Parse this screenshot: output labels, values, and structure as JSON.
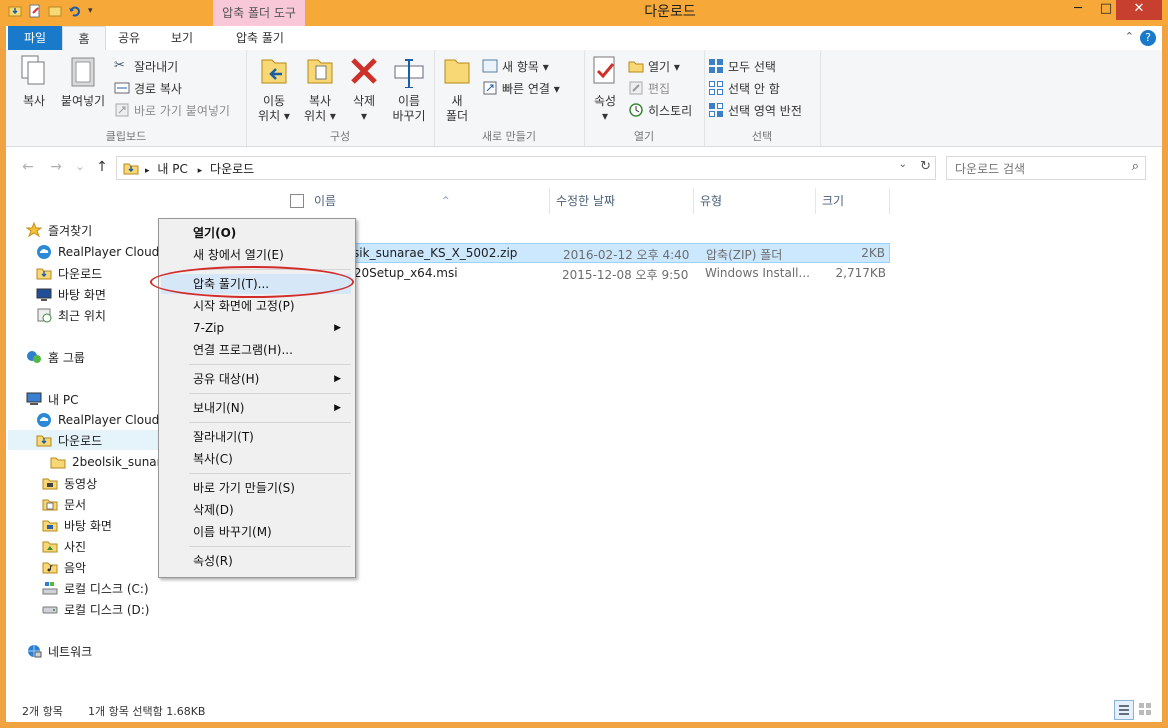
{
  "window": {
    "title": "다운로드",
    "contextual_tool": "압축 폴더 도구",
    "min_glyph": "─",
    "max_glyph": "□",
    "close_glyph": "✕"
  },
  "tabs": {
    "file": "파일",
    "home": "홈",
    "share": "공유",
    "view": "보기",
    "extract": "압축 풀기",
    "help": "?"
  },
  "ribbon": {
    "clipboard": {
      "label": "클립보드",
      "copy": "복사",
      "paste": "붙여넣기",
      "cut": "잘라내기",
      "copy_path": "경로 복사",
      "paste_shortcut": "바로 가기 붙여넣기"
    },
    "organize": {
      "label": "구성",
      "move_to_1": "이동",
      "move_to_2": "위치 ▾",
      "copy_to_1": "복사",
      "copy_to_2": "위치 ▾",
      "delete_1": "삭제",
      "delete_2": "▾",
      "rename_1": "이름",
      "rename_2": "바꾸기"
    },
    "new": {
      "label": "새로 만들기",
      "new_folder_1": "새",
      "new_folder_2": "폴더",
      "new_item": "새 항목 ▾",
      "easy_access": "빠른 연결 ▾"
    },
    "open": {
      "label": "열기",
      "properties_1": "속성",
      "properties_2": "▾",
      "open": "열기 ▾",
      "edit": "편집",
      "history": "히스토리"
    },
    "select": {
      "label": "선택",
      "select_all": "모두 선택",
      "select_none": "선택 안 함",
      "invert": "선택 영역 반전"
    }
  },
  "address": {
    "back": "←",
    "forward": "→",
    "recent": "⌄",
    "up": "↑",
    "root_sep": "▸",
    "pc": "내 PC",
    "sep": "▸",
    "folder": "다운로드",
    "dropdown": "⌄",
    "refresh": "↻",
    "search_placeholder": "다운로드 검색",
    "search_glyph": "⌕"
  },
  "navpane": [
    {
      "label": "즐겨찾기",
      "icon": "star-icon"
    },
    {
      "label": "RealPlayer Cloud",
      "icon": "cloud-icon"
    },
    {
      "label": "다운로드",
      "icon": "download-folder-icon"
    },
    {
      "label": "바탕 화면",
      "icon": "desktop-icon"
    },
    {
      "label": "최근 위치",
      "icon": "recent-places-icon"
    },
    {
      "label": "홈 그룹",
      "icon": "homegroup-icon"
    },
    {
      "label": "내 PC",
      "icon": "computer-icon"
    },
    {
      "label": "RealPlayer Cloud",
      "icon": "cloud-icon"
    },
    {
      "label": "다운로드",
      "icon": "download-folder-icon"
    },
    {
      "label": "2beolsik_sunara",
      "icon": "folder-icon"
    },
    {
      "label": "동영상",
      "icon": "videos-folder-icon"
    },
    {
      "label": "문서",
      "icon": "documents-folder-icon"
    },
    {
      "label": "바탕 화면",
      "icon": "desktop-folder-icon"
    },
    {
      "label": "사진",
      "icon": "pictures-folder-icon"
    },
    {
      "label": "음악",
      "icon": "music-folder-icon"
    },
    {
      "label": "로컬 디스크 (C:)",
      "icon": "drive-c-icon"
    },
    {
      "label": "로컬 디스크 (D:)",
      "icon": "drive-d-icon"
    },
    {
      "label": "네트워크",
      "icon": "network-icon"
    }
  ],
  "columns": {
    "name": "이름",
    "date": "수정한 날짜",
    "type": "유형",
    "size": "크기",
    "sort_glyph": "^"
  },
  "files": [
    {
      "name": "eolsik_sunarae_KS_X_5002.zip",
      "date": "2016-02-12 오후 4:40",
      "type": "압축(ZIP) 폴더",
      "size": "2KB"
    },
    {
      "name": "s820Setup_x64.msi",
      "date": "2015-12-08 오후 9:50",
      "type": "Windows Install...",
      "size": "2,717KB"
    }
  ],
  "context_menu": {
    "open": "열기(O)",
    "open_new_window": "새 창에서 열기(E)",
    "extract_all": "압축 풀기(T)...",
    "pin_start": "시작 화면에 고정(P)",
    "seven_zip": "7-Zip",
    "open_with": "연결 프로그램(H)...",
    "share_with": "공유 대상(H)",
    "send_to": "보내기(N)",
    "cut": "잘라내기(T)",
    "copy": "복사(C)",
    "create_shortcut": "바로 가기 만들기(S)",
    "delete": "삭제(D)",
    "rename": "이름 바꾸기(M)",
    "properties": "속성(R)",
    "submenu_glyph": "▶"
  },
  "status": {
    "count": "2개 항목",
    "selected": "1개 항목 선택함 1.68KB"
  },
  "colors": {
    "title_bar": "#f6a838",
    "file_tab": "#1979ca",
    "selection": "#cce8ff",
    "annotation": "#d12b2b"
  }
}
